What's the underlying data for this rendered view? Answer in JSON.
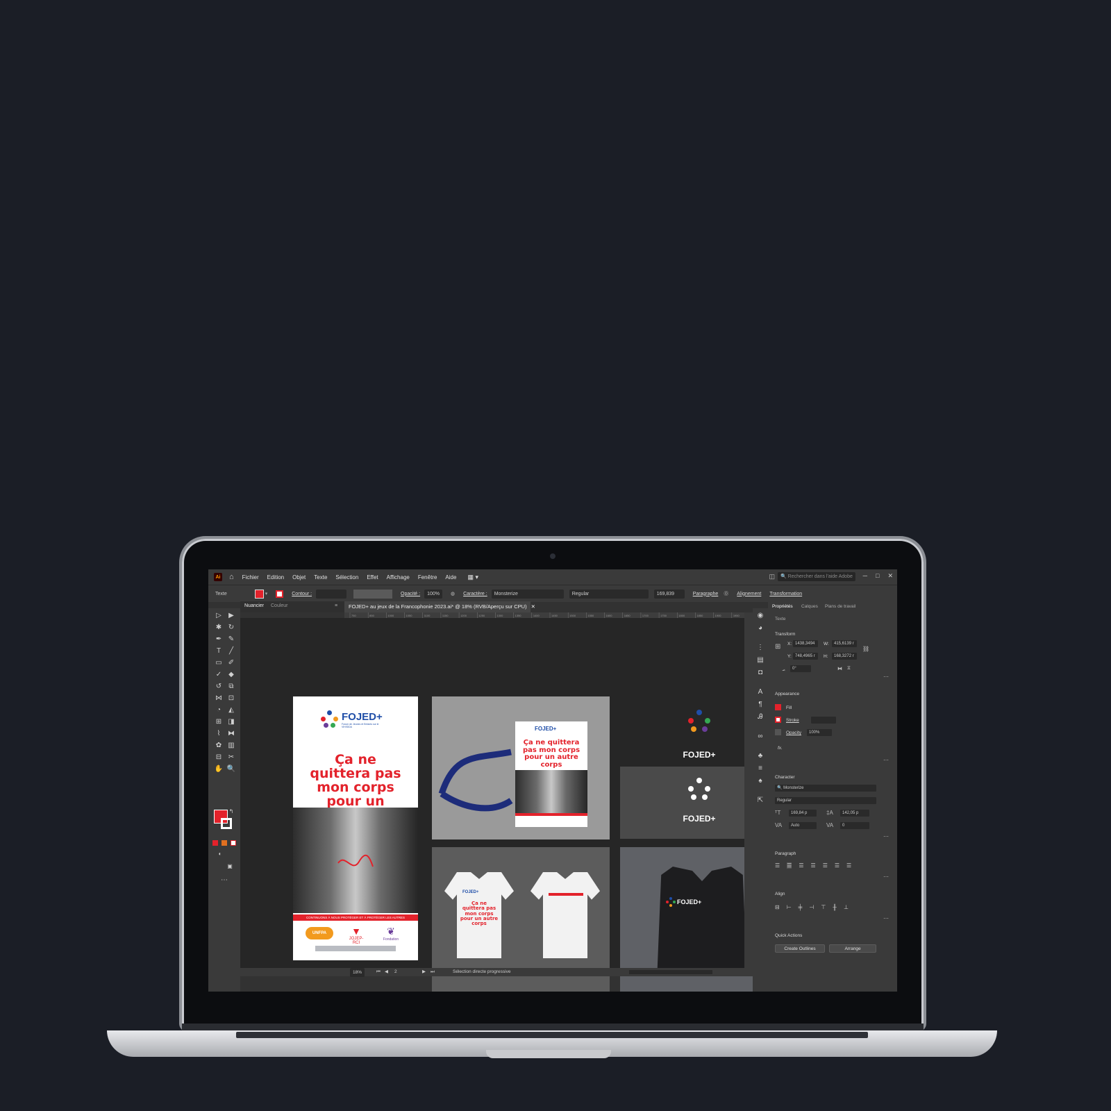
{
  "menubar": {
    "app_icon": "Ai",
    "items": [
      "Fichier",
      "Edition",
      "Objet",
      "Texte",
      "Sélection",
      "Effet",
      "Affichage",
      "Fenêtre",
      "Aide"
    ],
    "search_placeholder": "Rechercher dans l'aide Adobe"
  },
  "controlbar": {
    "mode_label": "Texte",
    "contour_label": "Contour :",
    "opacity_label": "Opacité :",
    "opacity_value": "100%",
    "char_label": "Caractère :",
    "font_value": "Monsterize",
    "style_value": "Regular",
    "size_value": "169,839",
    "paragraph_label": "Paragraphe",
    "align_label": "Alignement",
    "transform_label": "Transformation"
  },
  "left_panel": {
    "tab_swatches": "Nuancier",
    "tab_color": "Couleur"
  },
  "document": {
    "tab_title": "FOJED+ au jeux de la Francophonie 2023.ai* @ 18% (RVB/Aperçu sur CPU)",
    "ruler_ticks": [
      "750",
      "850",
      "1000",
      "1050",
      "1100",
      "1150",
      "1200",
      "1250",
      "1300",
      "1350",
      "1400",
      "1450",
      "1500",
      "1550",
      "1600",
      "1650",
      "1700",
      "1750",
      "1800",
      "1850",
      "1900",
      "1950"
    ]
  },
  "artwork": {
    "brand": "FOJED+",
    "brand_tagline": "Forum de Jeunes et Enfants sur le VIH/SIDA",
    "slogan": "Ça ne quittera pas mon corps pour un autre corps",
    "band_text": "CONTINUONS À NOUS PROTÉGER ET À PROTÉGER LES AUTRES",
    "partner_1": "UNFPA",
    "partner_2": "JOJEP-RCI",
    "partner_3": "Fondation"
  },
  "statusbar": {
    "zoom": "18%",
    "page": "2",
    "tool_status": "Sélection directe progressive"
  },
  "properties": {
    "tabs": [
      "Propriétés",
      "Calques",
      "Plans de travail"
    ],
    "type_label": "Texte",
    "transform": {
      "title": "Transform",
      "x_label": "X:",
      "x": "1438,3494",
      "y_label": "Y:",
      "y": "748,4965 r",
      "w_label": "W:",
      "w": "415,6139 r",
      "h_label": "H:",
      "h": "168,3272 r",
      "angle": "0°"
    },
    "appearance": {
      "title": "Appearance",
      "fill": "Fill",
      "stroke": "Stroke",
      "opacity": "Opacity",
      "opacity_value": "100%",
      "fx": "fx."
    },
    "character": {
      "title": "Character",
      "font": "Monsterize",
      "style": "Regular",
      "size": "169,84 p",
      "leading": "142,05 p",
      "kerning": "Auto",
      "tracking": "0"
    },
    "paragraph": {
      "title": "Paragraph"
    },
    "align": {
      "title": "Align"
    },
    "quick_actions": {
      "title": "Quick Actions",
      "create_outlines": "Create Outlines",
      "arrange": "Arrange"
    }
  },
  "colors": {
    "background": "#1b1e26",
    "accent_red": "#e3222b",
    "brand_blue": "#1f4ea8",
    "ui_dark": "#323232"
  }
}
